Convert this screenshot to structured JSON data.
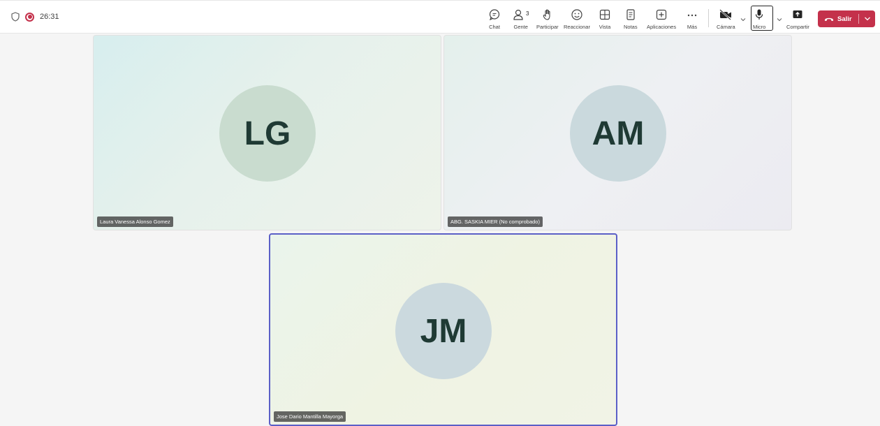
{
  "status": {
    "timer": "26:31"
  },
  "toolbar": {
    "chat": "Chat",
    "people": "Gente",
    "people_count": "3",
    "raise": "Participar",
    "react": "Reaccionar",
    "view": "Vista",
    "notes": "Notas",
    "apps": "Aplicaciones",
    "more": "Más",
    "camera": "Cámara",
    "mic": "Micro",
    "share": "Compartir",
    "leave": "Salir"
  },
  "colors": {
    "leave_bg": "#c4314b",
    "active_speaker_border": "#5b5fc7",
    "recording": "#c4314b"
  },
  "participants": [
    {
      "initials": "LG",
      "name": "Laura Vanessa Alonso Gomez",
      "avatar_color": "#c9dccf"
    },
    {
      "initials": "AM",
      "name": "ABG. SASKIA MIER (No comprobado)",
      "avatar_color": "#cad9dd"
    },
    {
      "initials": "JM",
      "name": "Jose Dario Mantilla Mayorga",
      "avatar_color": "#cbd9de"
    }
  ]
}
